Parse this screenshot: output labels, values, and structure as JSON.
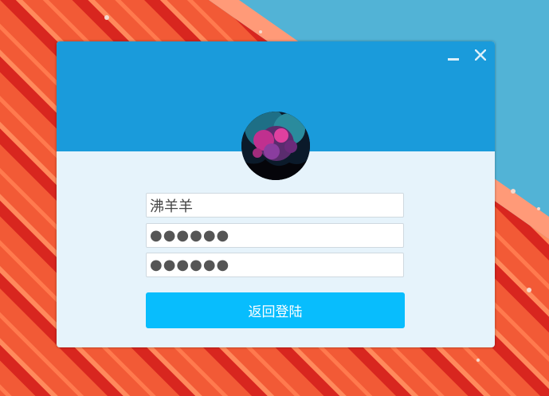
{
  "window": {
    "username": "沸羊羊",
    "password_mask": "●●●●●●",
    "confirm_password_mask": "●●●●●●",
    "return_login_label": "返回登陆",
    "minimize_icon": "minimize-icon",
    "close_icon": "close-icon"
  },
  "colors": {
    "header": "#1a9bdb",
    "body": "#e6f3fb",
    "button": "#08bdfd",
    "wallpaper_red": "#ee3b2c",
    "wallpaper_sky": "#52b3d6"
  }
}
